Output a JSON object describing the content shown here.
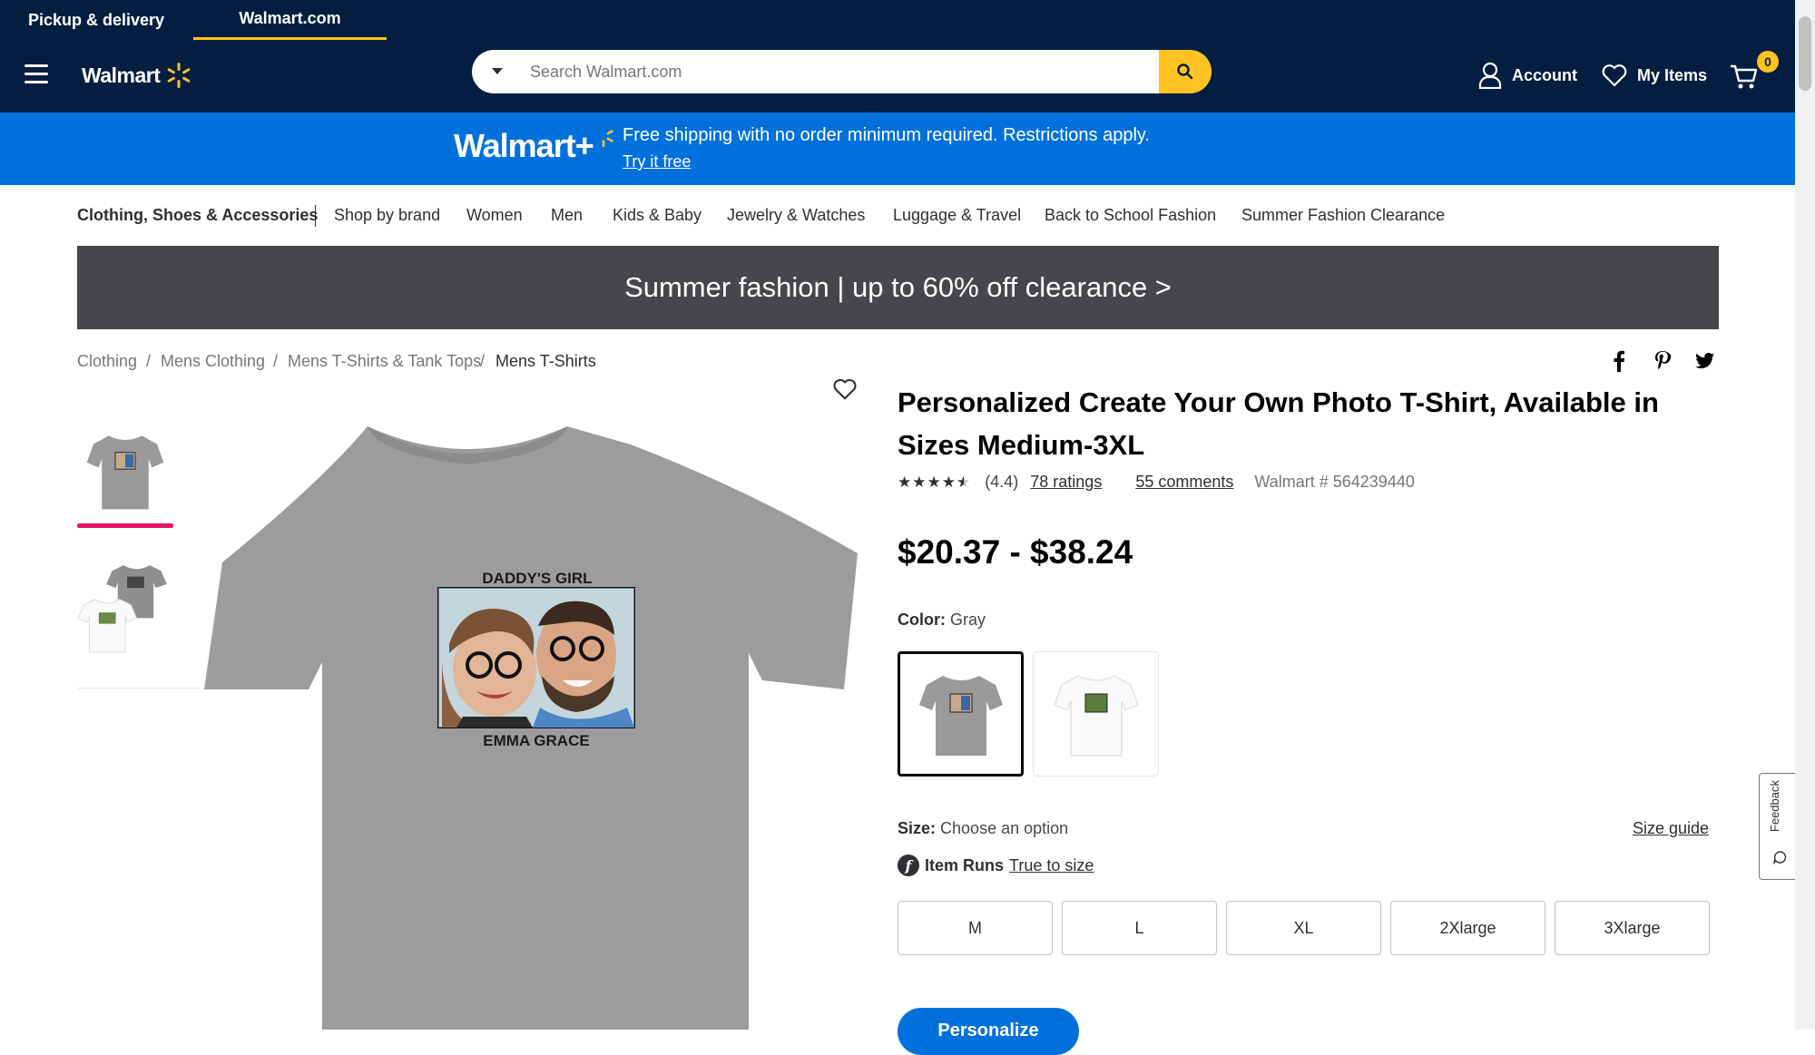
{
  "header": {
    "tabs": [
      "Pickup & delivery",
      "Walmart.com"
    ],
    "logo_text": "Walmart",
    "search_placeholder": "Search Walmart.com",
    "account_label": "Account",
    "my_items_label": "My Items",
    "cart_count": "0",
    "colors": {
      "navy": "#041e42",
      "yellow": "#ffc220",
      "blue": "#0071dc"
    }
  },
  "plus_banner": {
    "logo_text": "Walmart+",
    "message": "Free shipping with no order minimum required. Restrictions apply.",
    "link": "Try it free"
  },
  "category_nav": {
    "items": [
      "Clothing, Shoes & Accessories",
      "Shop by brand",
      "Women",
      "Men",
      "Kids & Baby",
      "Jewelry & Watches",
      "Luggage & Travel",
      "Back to School Fashion",
      "Summer Fashion Clearance"
    ]
  },
  "promo": {
    "text": "Summer fashion | up to 60% off clearance >"
  },
  "breadcrumbs": [
    "Clothing",
    "Mens Clothing",
    "Mens T-Shirts & Tank Tops",
    "Mens T-Shirts"
  ],
  "gallery": {
    "shirt_top_text": "DADDY'S GIRL",
    "shirt_bottom_text": "EMMA GRACE",
    "thumbnails": [
      "gray-shirt-thumbnail",
      "gray-and-white-shirts-thumbnail"
    ]
  },
  "product": {
    "title": "Personalized Create Your Own Photo T-Shirt, Available in Sizes Medium-3XL",
    "stars": 4.4,
    "rating_value": "(4.4)",
    "ratings_link": "78 ratings",
    "comments_link": "55 comments",
    "walmart_number": "Walmart # 564239440",
    "price": "$20.37 - $38.24",
    "color_label": "Color:",
    "color_value": "Gray",
    "size_label": "Size:",
    "size_value": "Choose an option",
    "size_guide": "Size guide",
    "fit_label": "Item Runs",
    "fit_link": "True to size",
    "sizes": [
      "M",
      "L",
      "XL",
      "2Xlarge",
      "3Xlarge"
    ],
    "cta_label": "Personalize"
  },
  "icons": [
    "menu-icon",
    "spark-icon",
    "search-icon",
    "user-icon",
    "heart-icon",
    "cart-icon",
    "facebook-icon",
    "pinterest-icon",
    "twitter-icon",
    "favorite-heart-icon",
    "fit-icon",
    "feedback-icon"
  ],
  "feedback_label": "Feedback"
}
